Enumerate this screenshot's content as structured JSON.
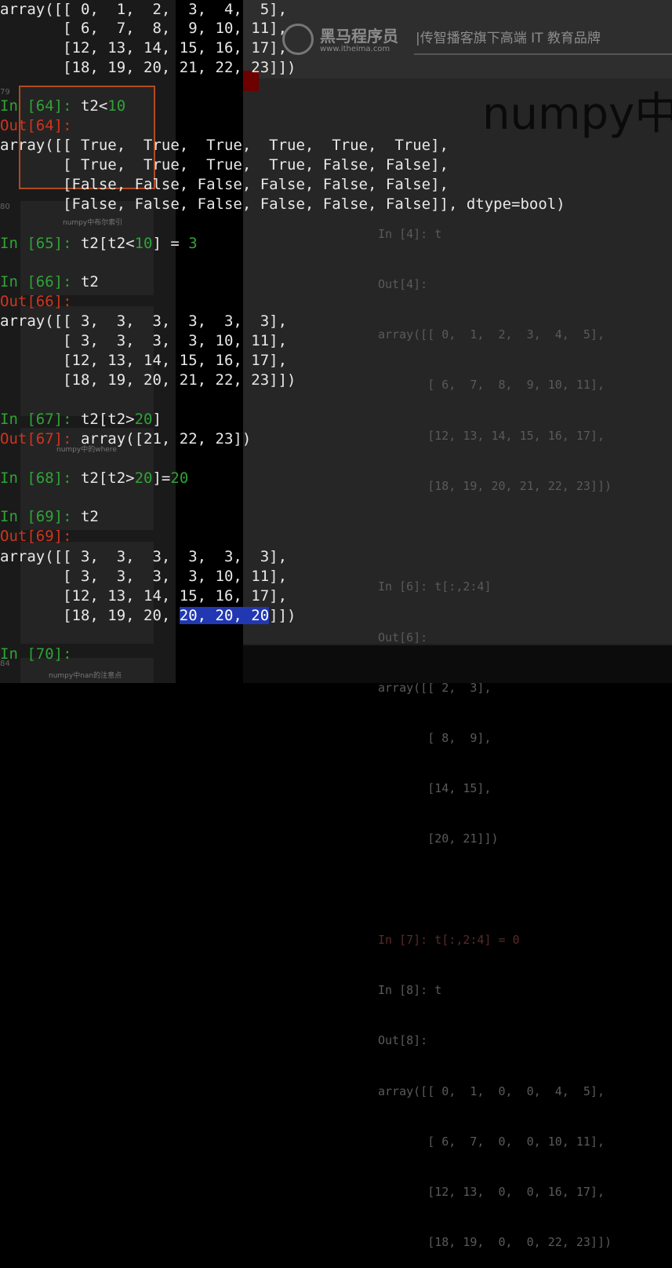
{
  "slide": {
    "brand_name": "黑马程序员",
    "brand_url": "www.itheima.com",
    "slogan": "|传智播客旗下高端 IT 教育品牌",
    "title": "numpy中",
    "code_lines": [
      "In [4]: t",
      "Out[4]:",
      "array([[ 0,  1,  2,  3,  4,  5],",
      "       [ 6,  7,  8,  9, 10, 11],",
      "       [12, 13, 14, 15, 16, 17],",
      "       [18, 19, 20, 21, 22, 23]])",
      "",
      "In [6]: t[:,2:4]",
      "Out[6]:",
      "array([[ 2,  3],",
      "       [ 8,  9],",
      "       [14, 15],",
      "       [20, 21]])",
      "",
      "In [7]: t[:,2:4] = 0",
      "In [8]: t",
      "Out[8]:",
      "array([[ 0,  1,  0,  0,  4,  5],",
      "       [ 6,  7,  0,  0, 10, 11],",
      "       [12, 13,  0,  0, 16, 17],",
      "       [18, 19,  0,  0, 22, 23]])"
    ]
  },
  "thumbnails": {
    "numbers": [
      "79",
      "80",
      "84"
    ],
    "labels": [
      "numpy中布尔索引",
      "numpy中的where",
      "numpy中nan的注意点"
    ]
  },
  "terminal": {
    "out_prev": [
      "array([[ 0,  1,  2,  3,  4,  5],",
      "       [ 6,  7,  8,  9, 10, 11],",
      "       [12, 13, 14, 15, 16, 17],",
      "       [18, 19, 20, 21, 22, 23]])"
    ],
    "cells": [
      {
        "prompt": "In [64]: ",
        "code_a": "t2<",
        "code_num": "10",
        "code_b": ""
      },
      {
        "out_prompt": "Out[64]:"
      },
      {
        "prompt": "In [65]: ",
        "code_a": "t2[t2<",
        "code_num": "10",
        "code_b": "] = ",
        "code_num2": "3"
      },
      {
        "prompt": "In [66]: ",
        "code_a": "t2"
      },
      {
        "out_prompt": "Out[66]:"
      },
      {
        "prompt": "In [67]: ",
        "code_a": "t2[t2>",
        "code_num": "20",
        "code_b": "]"
      },
      {
        "out_prompt": "Out[67]: ",
        "inline": "array([21, 22, 23])"
      },
      {
        "prompt": "In [68]: ",
        "code_a": "t2[t2>",
        "code_num": "20",
        "code_b": "]=",
        "code_num2": "20"
      },
      {
        "prompt": "In [69]: ",
        "code_a": "t2"
      },
      {
        "out_prompt": "Out[69]:"
      },
      {
        "prompt": "In [70]: "
      }
    ],
    "out64": [
      "array([[ True,  True,  True,  True,  True,  True],",
      "       [ True,  True,  True,  True, False, False],",
      "       [False, False, False, False, False, False],",
      "       [False, False, False, False, False, False]], dtype=bool)"
    ],
    "out66": [
      "array([[ 3,  3,  3,  3,  3,  3],",
      "       [ 3,  3,  3,  3, 10, 11],",
      "       [12, 13, 14, 15, 16, 17],",
      "       [18, 19, 20, 21, 22, 23]])"
    ],
    "out69": [
      "array([[ 3,  3,  3,  3,  3,  3],",
      "       [ 3,  3,  3,  3, 10, 11],",
      "       [12, 13, 14, 15, 16, 17],"
    ],
    "out69_last_pre": "       [18, 19, 20, ",
    "out69_last_sel": "20, 20, 20",
    "out69_last_post": "]])"
  }
}
